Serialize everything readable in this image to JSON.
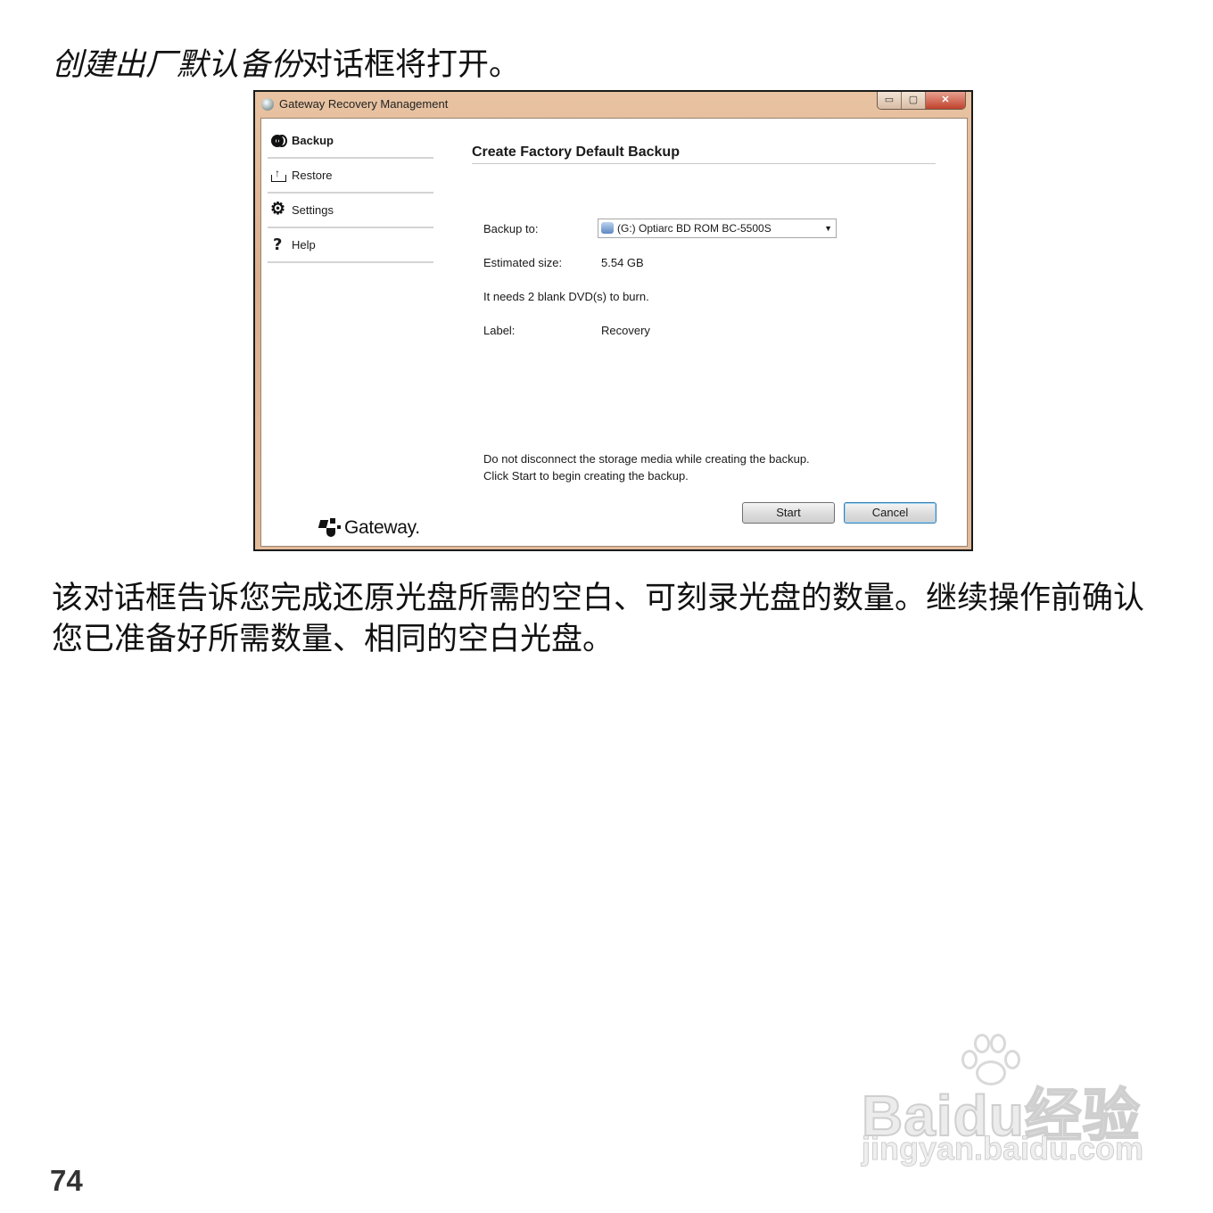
{
  "intro": {
    "italic_part": "创建出厂默认备份",
    "rest": "对话框将打开。"
  },
  "dialog": {
    "title": "Gateway Recovery Management",
    "window_buttons": {
      "minimize": "▭",
      "maximize": "▢",
      "close": "✕"
    },
    "nav": [
      {
        "label": "Backup",
        "icon": "backup-disc-icon",
        "active": true
      },
      {
        "label": "Restore",
        "icon": "restore-icon",
        "active": false
      },
      {
        "label": "Settings",
        "icon": "gear-icon",
        "active": false
      },
      {
        "label": "Help",
        "icon": "help-icon",
        "active": false
      }
    ],
    "heading": "Create Factory Default Backup",
    "backup_to_label": "Backup to:",
    "backup_to_value": "(G:) Optiarc  BD ROM BC-5500S",
    "estimated_size_label": "Estimated size:",
    "estimated_size_value": "5.54 GB",
    "dvd_note": "It needs 2 blank DVD(s) to burn.",
    "label_label": "Label:",
    "label_value": "Recovery",
    "warning_line1": "Do not disconnect the storage media while creating the backup.",
    "warning_line2": "Click Start to begin creating the backup.",
    "start_button": "Start",
    "cancel_button": "Cancel",
    "logo_text": "Gateway."
  },
  "body_text": "该对话框告诉您完成还原光盘所需的空白、可刻录光盘的数量。继续操作前确认您已准备好所需数量、相同的空白光盘。",
  "watermark": {
    "main": "Baidu经验",
    "sub": "jingyan.baidu.com"
  },
  "page_number": "74"
}
